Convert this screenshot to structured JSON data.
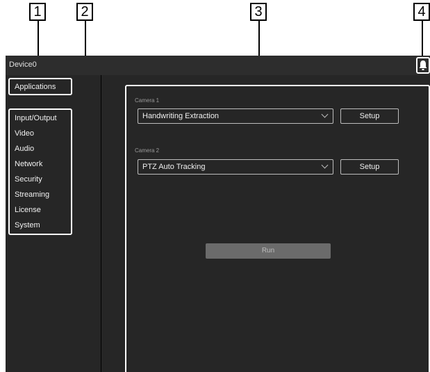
{
  "callouts": [
    "1",
    "2",
    "3",
    "4"
  ],
  "titlebar": {
    "device": "Device0",
    "bell_icon": "bell-icon"
  },
  "sidebar": {
    "applications": "Applications",
    "items": [
      {
        "label": "Input/Output"
      },
      {
        "label": "Video"
      },
      {
        "label": "Audio"
      },
      {
        "label": "Network"
      },
      {
        "label": "Security"
      },
      {
        "label": "Streaming"
      },
      {
        "label": "License"
      },
      {
        "label": "System"
      }
    ]
  },
  "main": {
    "camera1": {
      "label": "Camera 1",
      "selected": "Handwriting Extraction",
      "setup_label": "Setup"
    },
    "camera2": {
      "label": "Camera 2",
      "selected": "PTZ Auto Tracking",
      "setup_label": "Setup"
    },
    "run_label": "Run"
  },
  "colors": {
    "background": "#000000",
    "panel": "#262626",
    "titlebar": "#2d2d2d",
    "run_button": "#6b6b6b",
    "highlight": "#ffffff"
  }
}
